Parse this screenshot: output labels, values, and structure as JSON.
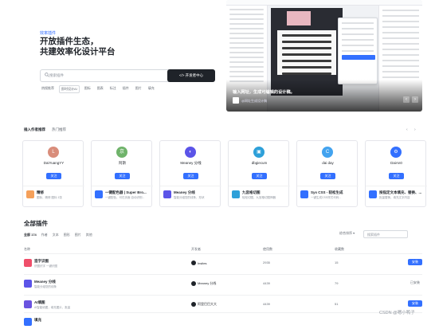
{
  "hero": {
    "tag": "效率插件",
    "title_line1": "开放插件生态，",
    "title_line2": "共建效率化设计平台",
    "search_placeholder": "搜索插件",
    "search_button": "开发者中心",
    "hot_label": "热搜推荐",
    "hot_items": [
      "即时设计AI",
      "图标",
      "图表",
      "标注",
      "插件",
      "图片",
      "填充"
    ]
  },
  "showcase": {
    "caption": "输入网址，生成可编辑的设计稿。",
    "author": "@网址生成设计稿"
  },
  "recommend": {
    "tabs": [
      "插入作者推荐",
      "热门推荐"
    ],
    "page_prev": "‹",
    "page_next": "›",
    "cards": [
      {
        "name": "DaiYuangYY",
        "avatar": "L",
        "avatar_color": "#d98d7b",
        "btn": "关注",
        "plugin": "精修",
        "desc": "图标，精修 图标 1张",
        "icon_color": "#f5a05a"
      },
      {
        "name": "阿斯",
        "avatar": "京",
        "avatar_color": "#6fb36a",
        "btn": "关注",
        "plugin": "一键配色器 | Super Bro...",
        "desc": "一键配色，可在页面 自动识别...",
        "icon_color": "#3370ff"
      },
      {
        "name": "Meaney 分线",
        "avatar": "◐",
        "avatar_color": "#5b54e8",
        "btn": "关注",
        "plugin": "Meaney 分线",
        "desc": "智能分组您的线条，形状",
        "icon_color": "#5b54e8"
      },
      {
        "name": "dbgiecum",
        "avatar": "▣",
        "avatar_color": "#2ea0d9",
        "btn": "关注",
        "plugin": "九宫格切图",
        "desc": "轻松切图，九宫格切图神器",
        "icon_color": "#2ea0d9"
      },
      {
        "name": "dai day",
        "avatar": "C",
        "avatar_color": "#43a3ef",
        "btn": "关注",
        "plugin": "Sys CSS - 轻松生成",
        "desc": "一键生成CSS样式代码...",
        "icon_color": "#3370ff"
      },
      {
        "name": "DaiAn0",
        "avatar": "⚙",
        "avatar_color": "#3370ff",
        "btn": "关注",
        "plugin": "按指定文本填充、替换、...",
        "desc": "批量替换，填充文字内容",
        "icon_color": "#3370ff"
      }
    ]
  },
  "all_plugins": {
    "title": "全部插件",
    "filter_tabs": [
      "全部 174",
      "作者",
      "文本",
      "图形",
      "图片",
      "其他"
    ],
    "sort_label": "综合排序 ▾",
    "search_placeholder": "搜索插件",
    "columns": [
      "名称",
      "开发者",
      "使用数",
      "收藏数"
    ],
    "rows": [
      {
        "name": "造字识图",
        "desc": "识图识字 一键识图",
        "icon_color": "#ef4f6a",
        "dev": "Insites",
        "uses": "2935",
        "favs": "15",
        "btn": "安装",
        "btn_style": "blue"
      },
      {
        "name": "Meaney 分线",
        "desc": "智能分组您的线条",
        "icon_color": "#5b54e8",
        "dev": "Meaney 分线",
        "uses": "4439",
        "favs": "79",
        "btn": "已安装",
        "btn_style": "gray"
      },
      {
        "name": "AI填图",
        "desc": "AI智能填图，填充图片，批量",
        "icon_color": "#6a53e0",
        "dev": "阿里巴巴大大",
        "uses": "4439",
        "favs": "51",
        "btn": "安装",
        "btn_style": "blue"
      },
      {
        "name": "填充",
        "desc": "",
        "icon_color": "#3370ff",
        "dev": "",
        "uses": "",
        "favs": "",
        "btn": "",
        "btn_style": "blue"
      }
    ]
  },
  "watermark": "CSDN @嗯小鸭子"
}
